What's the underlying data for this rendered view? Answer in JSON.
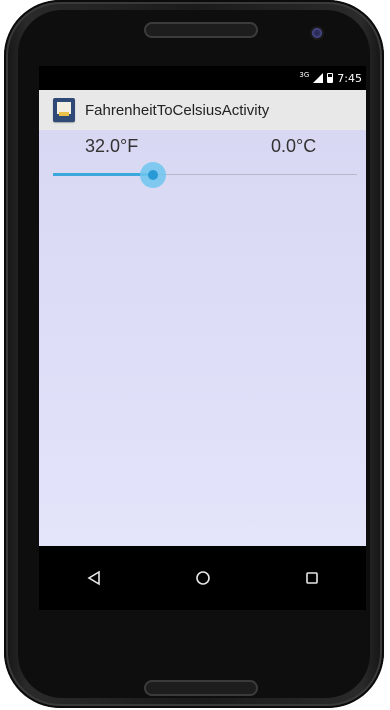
{
  "status_bar": {
    "network": "3G",
    "time": "7:45"
  },
  "action_bar": {
    "title": "FahrenheitToCelsiusActivity",
    "app_icon": "app-launcher-icon"
  },
  "converter": {
    "fahrenheit_text": "32.0°F",
    "celsius_text": "0.0°C",
    "slider_fraction": 0.33,
    "accent_color": "#3aa7dd"
  },
  "nav_bar": {
    "back_icon": "back-triangle-icon",
    "home_icon": "home-circle-icon",
    "recents_icon": "recents-square-icon"
  }
}
